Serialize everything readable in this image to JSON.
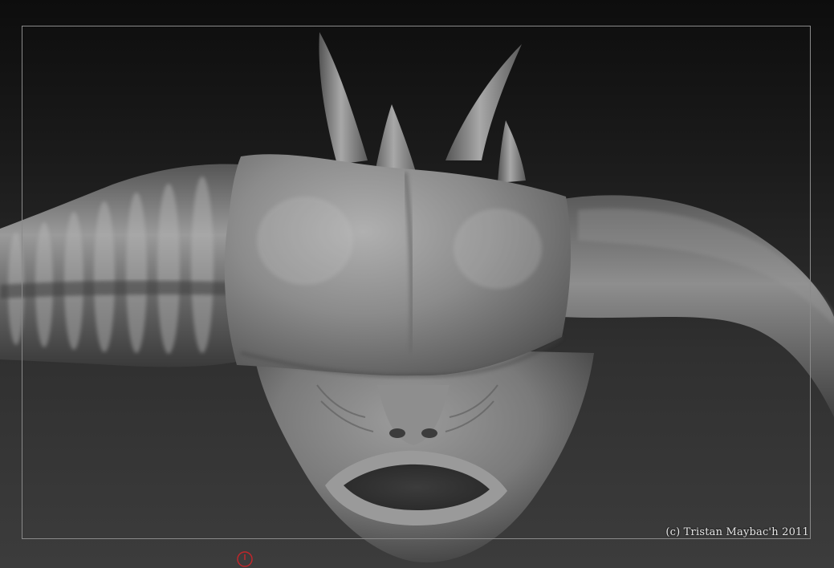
{
  "canvas": {
    "background_top": "#0d0d0d",
    "background_bottom": "#3c3c3c",
    "frame_color": "#8a8a8a"
  },
  "model": {
    "surface_color": "#7f7f7f",
    "highlight_color": "#b5b5b5",
    "shadow_color": "#3a3a3a"
  },
  "copyright": "(c) Tristan Maybac'h 2011",
  "cursor": {
    "icon": "brush-cursor-icon",
    "color": "#c0262b"
  }
}
